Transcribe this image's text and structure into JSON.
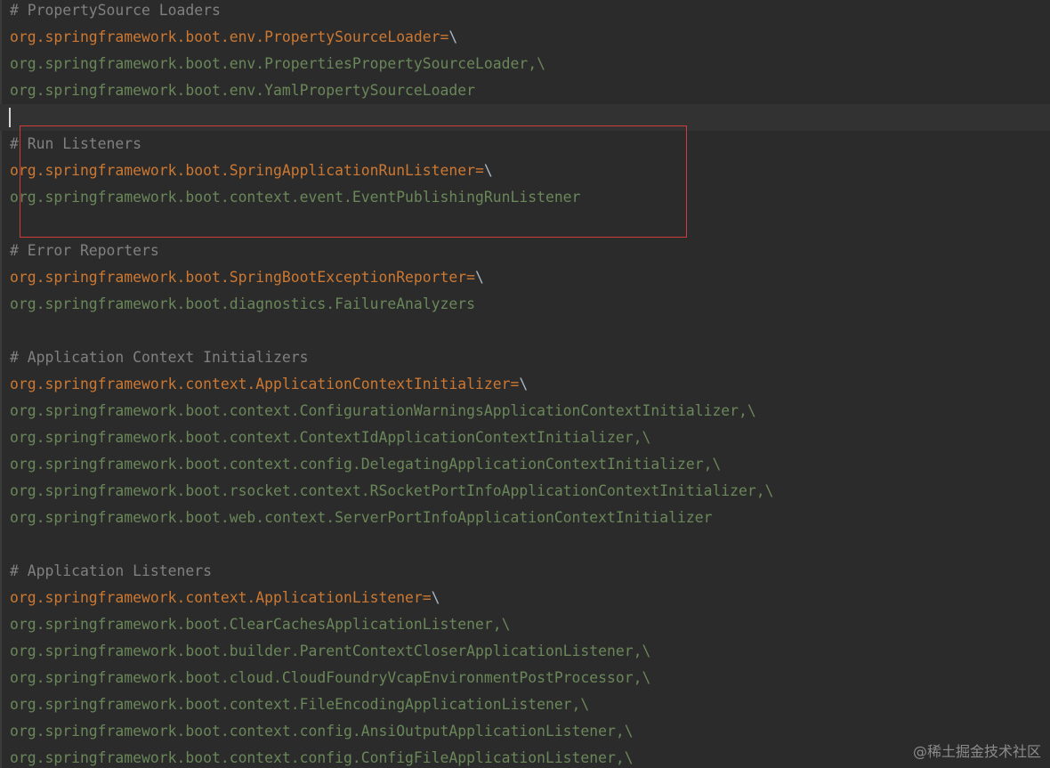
{
  "colors": {
    "background": "#2b2b2b",
    "current_line": "#323232",
    "comment": "#808080",
    "key": "#cc7832",
    "value": "#6a8759",
    "highlight_box": "#d03b3b"
  },
  "editor": {
    "current_line_index": 4,
    "lines": [
      {
        "kind": "comment",
        "text": "# PropertySource Loaders"
      },
      {
        "kind": "key",
        "text": "org.springframework.boot.env.PropertySourceLoader",
        "suffix": "=\\"
      },
      {
        "kind": "value",
        "text": "org.springframework.boot.env.PropertiesPropertySourceLoader,\\"
      },
      {
        "kind": "value",
        "text": "org.springframework.boot.env.YamlPropertySourceLoader"
      },
      {
        "kind": "blank",
        "text": ""
      },
      {
        "kind": "comment",
        "text": "# Run Listeners"
      },
      {
        "kind": "key",
        "text": "org.springframework.boot.SpringApplicationRunListener",
        "suffix": "=\\"
      },
      {
        "kind": "value",
        "text": "org.springframework.boot.context.event.EventPublishingRunListener"
      },
      {
        "kind": "blank",
        "text": ""
      },
      {
        "kind": "comment",
        "text": "# Error Reporters"
      },
      {
        "kind": "key",
        "text": "org.springframework.boot.SpringBootExceptionReporter",
        "suffix": "=\\"
      },
      {
        "kind": "value",
        "text": "org.springframework.boot.diagnostics.FailureAnalyzers"
      },
      {
        "kind": "blank",
        "text": ""
      },
      {
        "kind": "comment",
        "text": "# Application Context Initializers"
      },
      {
        "kind": "key",
        "text": "org.springframework.context.ApplicationContextInitializer",
        "suffix": "=\\"
      },
      {
        "kind": "value",
        "text": "org.springframework.boot.context.ConfigurationWarningsApplicationContextInitializer,\\"
      },
      {
        "kind": "value",
        "text": "org.springframework.boot.context.ContextIdApplicationContextInitializer,\\"
      },
      {
        "kind": "value",
        "text": "org.springframework.boot.context.config.DelegatingApplicationContextInitializer,\\"
      },
      {
        "kind": "value",
        "text": "org.springframework.boot.rsocket.context.RSocketPortInfoApplicationContextInitializer,\\"
      },
      {
        "kind": "value",
        "text": "org.springframework.boot.web.context.ServerPortInfoApplicationContextInitializer"
      },
      {
        "kind": "blank",
        "text": ""
      },
      {
        "kind": "comment",
        "text": "# Application Listeners"
      },
      {
        "kind": "key",
        "text": "org.springframework.context.ApplicationListener",
        "suffix": "=\\"
      },
      {
        "kind": "value",
        "text": "org.springframework.boot.ClearCachesApplicationListener,\\"
      },
      {
        "kind": "value",
        "text": "org.springframework.boot.builder.ParentContextCloserApplicationListener,\\"
      },
      {
        "kind": "value",
        "text": "org.springframework.boot.cloud.CloudFoundryVcapEnvironmentPostProcessor,\\"
      },
      {
        "kind": "value",
        "text": "org.springframework.boot.context.FileEncodingApplicationListener,\\"
      },
      {
        "kind": "value",
        "text": "org.springframework.boot.context.config.AnsiOutputApplicationListener,\\"
      },
      {
        "kind": "value",
        "text": "org.springframework.boot.context.config.ConfigFileApplicationListener,\\"
      }
    ]
  },
  "watermark": "@稀土掘金技术社区"
}
